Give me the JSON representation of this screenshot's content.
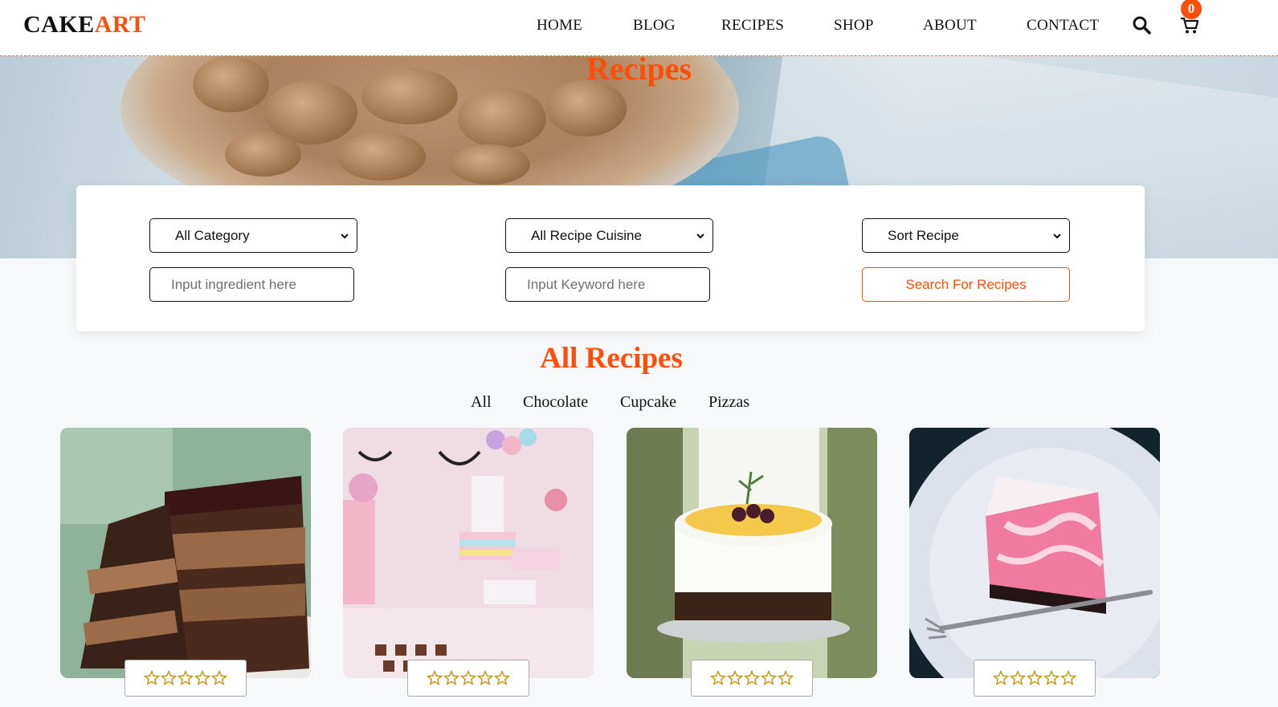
{
  "brand": {
    "part1": "CAKE",
    "part2": "ART"
  },
  "nav": {
    "items": [
      "HOME",
      "BLOG",
      "RECIPES",
      "SHOP",
      "ABOUT",
      "CONTACT"
    ],
    "cart_count": "0",
    "icons": [
      "search-icon",
      "cart-icon"
    ]
  },
  "hero": {
    "title": "Recipes"
  },
  "search": {
    "category_select": "All Category",
    "cuisine_select": "All Recipe Cuisine",
    "sort_select": "Sort Recipe",
    "ingredient_placeholder": "Input ingredient here",
    "keyword_placeholder": "Input Keyword here",
    "submit_label": "Search For Recipes"
  },
  "recipes": {
    "title": "All Recipes",
    "filters": [
      "All",
      "Chocolate",
      "Cupcake",
      "Pizzas"
    ],
    "cards": [
      {
        "image": "chocolate layer cake slice",
        "rating": 0,
        "max_rating": 5
      },
      {
        "image": "unicorn party dessert table",
        "rating": 0,
        "max_rating": 5
      },
      {
        "image": "white cake with fruit topping",
        "rating": 0,
        "max_rating": 5
      },
      {
        "image": "pink cheesecake slice with fork",
        "rating": 0,
        "max_rating": 5
      }
    ]
  },
  "colors": {
    "accent": "#ff4d0a",
    "star": "#c9961a"
  }
}
